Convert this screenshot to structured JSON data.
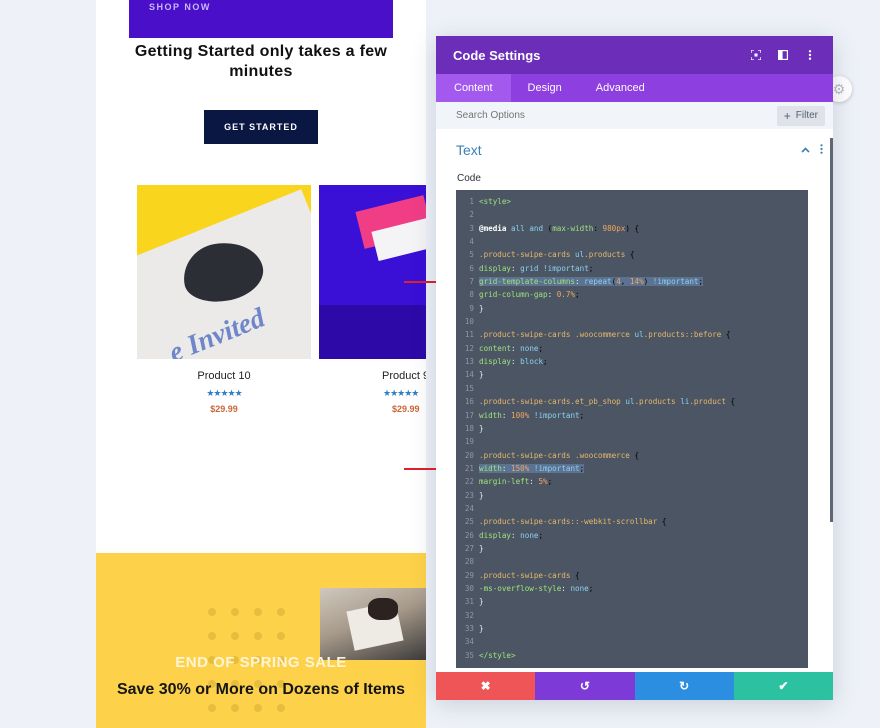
{
  "preview": {
    "shop_now": "SHOP NOW",
    "hero_title": "Getting Started only takes a few minutes",
    "get_started": "GET STARTED",
    "products": [
      {
        "name": "Product 10",
        "rating": "★★★★★",
        "price": "$29.99",
        "image_text": "e Invited"
      },
      {
        "name": "Product 9",
        "rating": "★★★★★",
        "price": "$29.99"
      }
    ],
    "sale_label": "END OF SPRING SALE",
    "sale_title": "Save 30% or More on Dozens of Items"
  },
  "modal": {
    "title": "Code Settings",
    "header_icons": [
      "focus-icon",
      "split-view-icon",
      "more-options-icon"
    ],
    "tabs": [
      {
        "label": "Content",
        "active": true
      },
      {
        "label": "Design",
        "active": false
      },
      {
        "label": "Advanced",
        "active": false
      }
    ],
    "search_placeholder": "Search Options",
    "filter_label": "Filter",
    "section_title": "Text",
    "code_label": "Code",
    "code_lines": [
      "<style>",
      "",
      "@media all and (max-width: 980px) {",
      "",
      ".product-swipe-cards ul.products {",
      "display: grid !important;",
      "grid-template-columns: repeat(4, 14%) !important;",
      "grid-column-gap: 0.7%;",
      "}",
      "",
      ".product-swipe-cards .woocommerce ul.products::before {",
      "content: none;",
      "display: block;",
      "}",
      "",
      ".product-swipe-cards.et_pb_shop ul.products li.product {",
      "width: 100% !important;",
      "}",
      "",
      ".product-swipe-cards .woocommerce {",
      "width: 150% !important;",
      "margin-left: 5%;",
      "}",
      "",
      ".product-swipe-cards::-webkit-scrollbar {",
      "display: none;",
      "}",
      "",
      ".product-swipe-cards {",
      "-ms-overflow-style: none;",
      "}",
      "",
      "}",
      "",
      "</style>"
    ],
    "highlighted_lines": [
      7,
      21
    ],
    "footer_buttons": [
      {
        "name": "cancel",
        "icon": "✖"
      },
      {
        "name": "undo",
        "icon": "↺"
      },
      {
        "name": "redo",
        "icon": "↻"
      },
      {
        "name": "save",
        "icon": "✔"
      }
    ]
  },
  "colors": {
    "modal_header": "#6c2eb9",
    "tabs_bar": "#8e3fdf",
    "editor_bg": "#4b5564",
    "cancel": "#ef5456",
    "undo": "#7d3ad6",
    "redo": "#2b8ee0",
    "save": "#2cc1a0"
  }
}
